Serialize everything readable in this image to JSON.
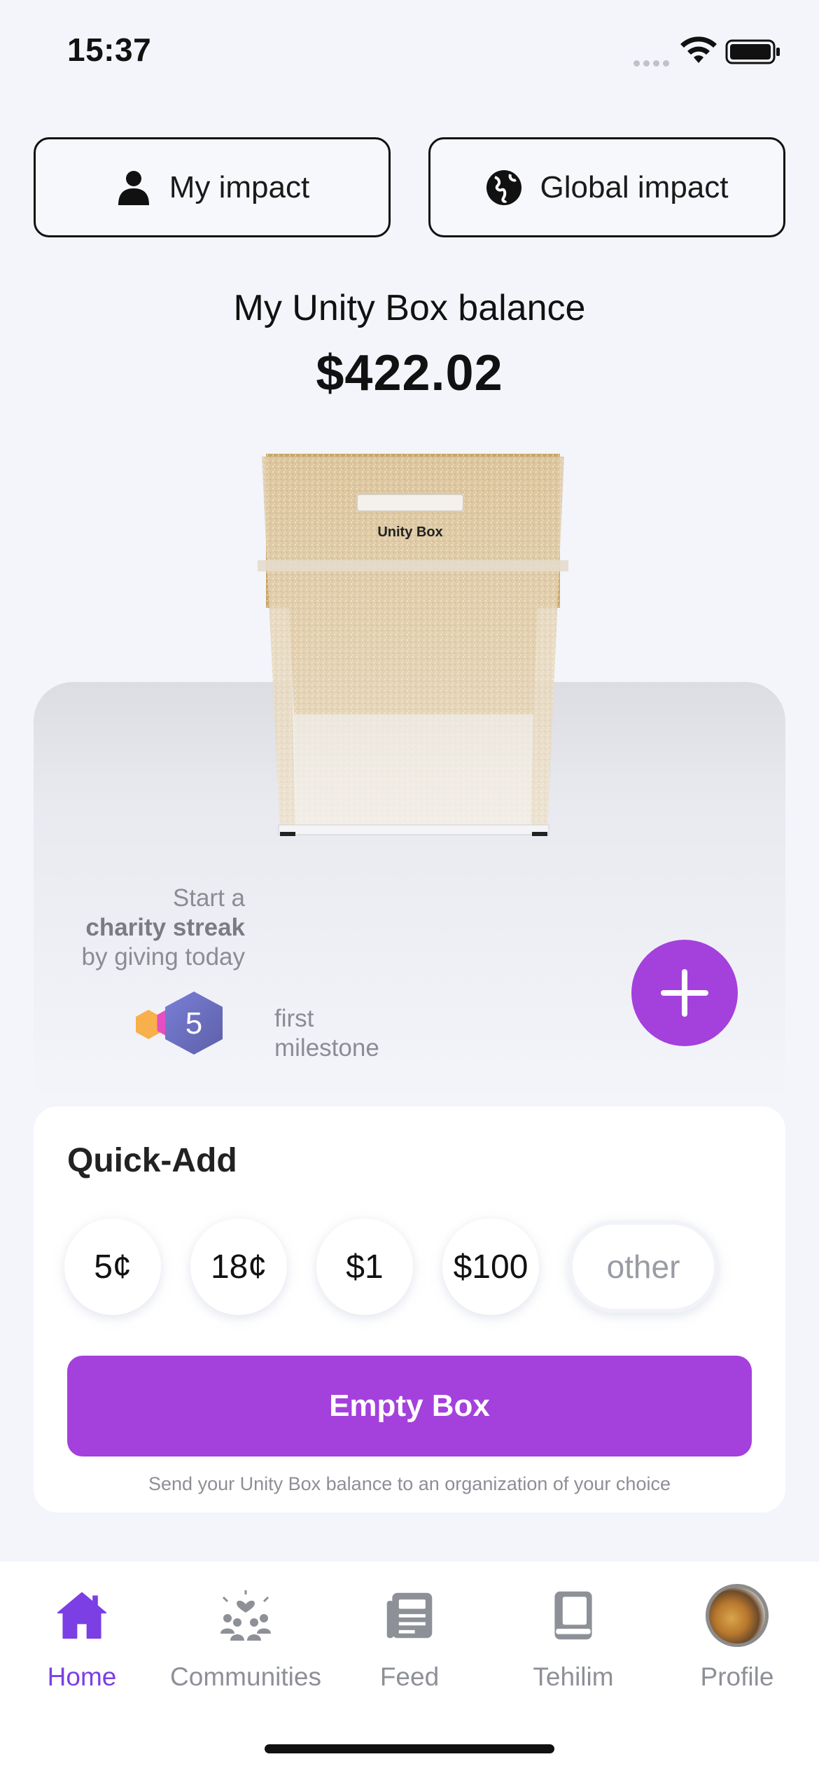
{
  "status_bar": {
    "time": "15:37"
  },
  "top_buttons": {
    "my_impact": "My impact",
    "global_impact": "Global impact"
  },
  "balance": {
    "label": "My Unity Box balance",
    "value": "$422.02"
  },
  "box": {
    "brand": "Unity Box"
  },
  "streak": {
    "line1": "Start a",
    "line2": "charity streak",
    "line3": "by giving today",
    "badge_number": "5",
    "milestone_line1": "first",
    "milestone_line2": "milestone"
  },
  "quick_add": {
    "title": "Quick-Add",
    "amounts": [
      "5¢",
      "18¢",
      "$1",
      "$100"
    ],
    "other": "other",
    "empty_button": "Empty Box",
    "caption": "Send your Unity Box balance to an organization of your choice"
  },
  "tabs": [
    {
      "label": "Home",
      "icon": "home-icon",
      "active": true
    },
    {
      "label": "Communities",
      "icon": "communities-icon",
      "active": false
    },
    {
      "label": "Feed",
      "icon": "feed-icon",
      "active": false
    },
    {
      "label": "Tehilim",
      "icon": "book-icon",
      "active": false
    },
    {
      "label": "Profile",
      "icon": "avatar",
      "active": false
    }
  ],
  "colors": {
    "accent": "#a440dc",
    "active_tab": "#7b3fe4",
    "background": "#f3f5fb"
  }
}
